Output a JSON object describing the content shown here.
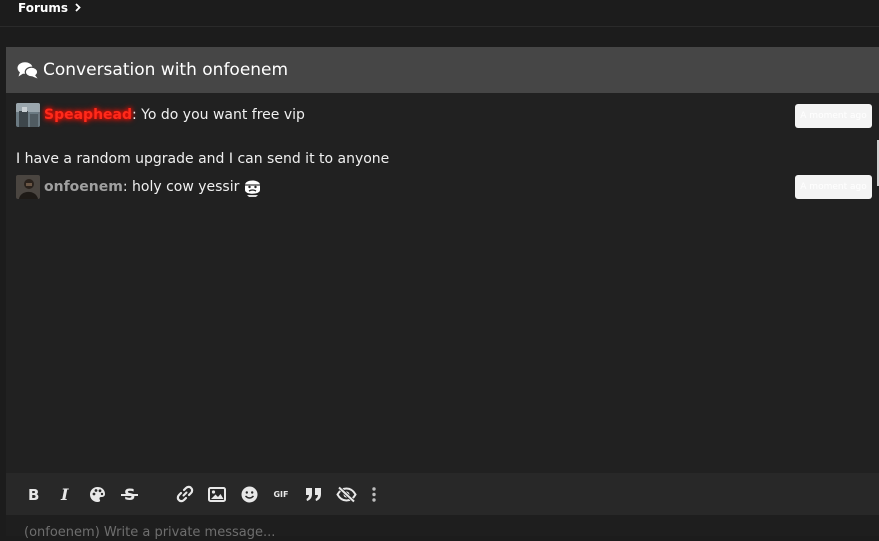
{
  "breadcrumb": {
    "label": "Forums"
  },
  "conversation": {
    "title": "Conversation with onfoenem"
  },
  "messages": [
    {
      "username": "Speaphead",
      "text": ": Yo do you want free vip",
      "time": "A moment ago"
    },
    {
      "text": "I have a random upgrade and I can send it to anyone"
    },
    {
      "username": "onfoenem",
      "text": ": holy cow yessir",
      "time": "A moment ago"
    }
  ],
  "toolbar": {
    "buttons": [
      "bold",
      "italic",
      "color",
      "strikethrough",
      "link",
      "image",
      "emoji",
      "gif",
      "quote",
      "spoiler",
      "more"
    ],
    "gif_label": "GIF"
  },
  "editor": {
    "placeholder": "(onfoenem) Write a private message..."
  }
}
